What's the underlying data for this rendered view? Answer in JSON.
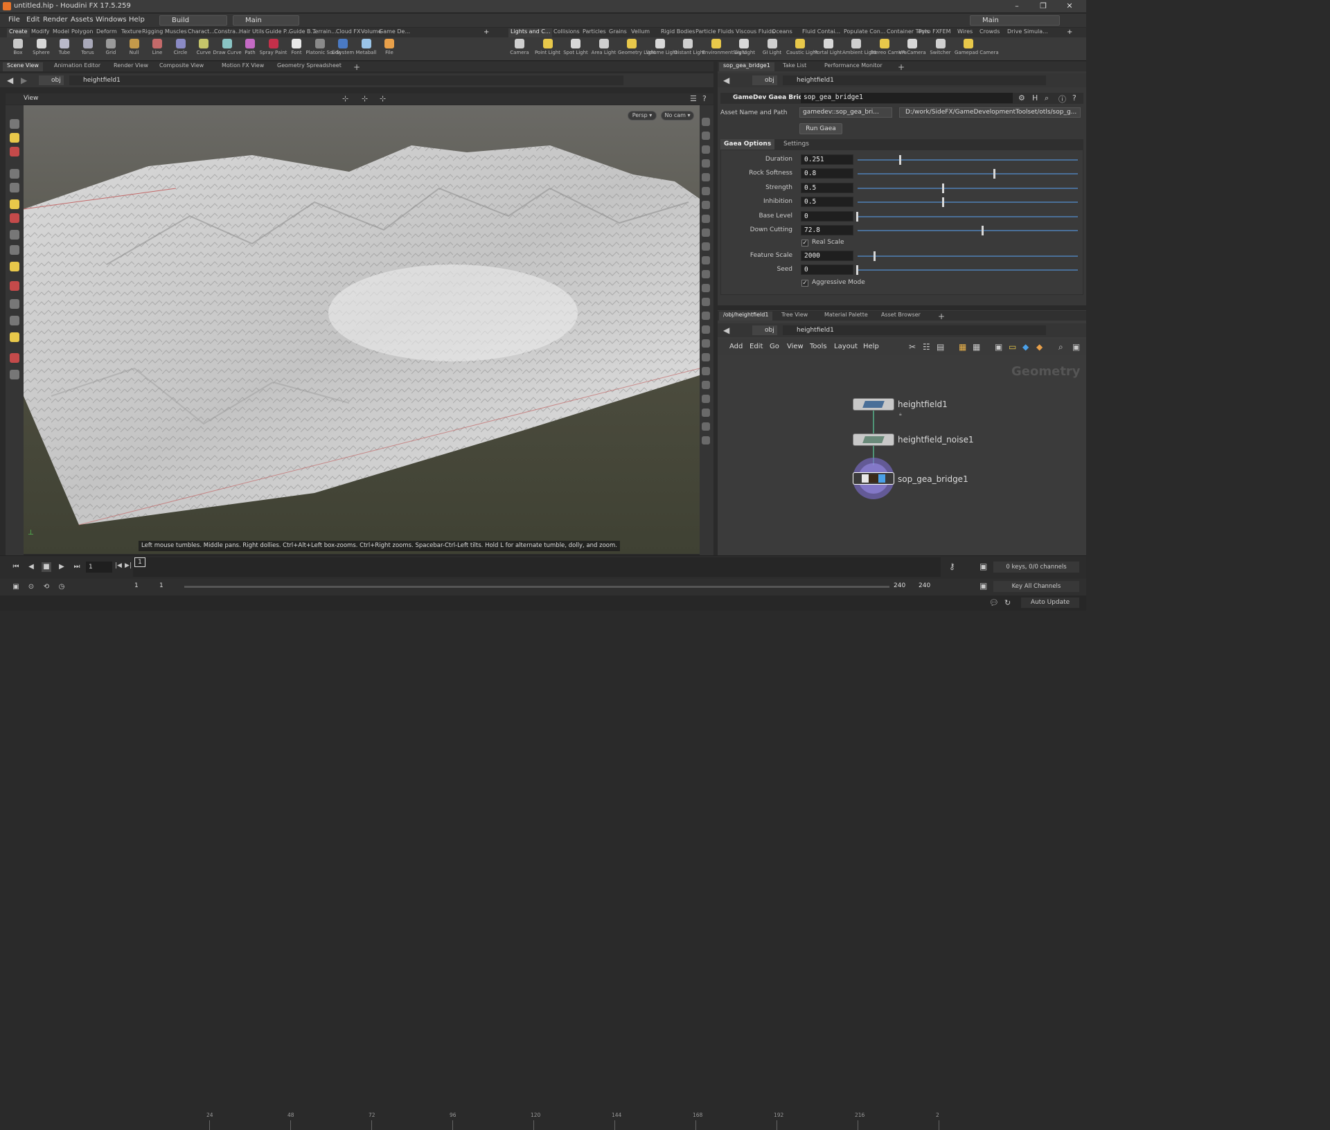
{
  "window": {
    "title": "untitled.hip - Houdini FX 17.5.259"
  },
  "menu": [
    "File",
    "Edit",
    "Render",
    "Assets",
    "Windows",
    "Help"
  ],
  "desktop": {
    "left": "Build",
    "center": "Main",
    "right": "Main"
  },
  "shelf_tabs_left": [
    "Create",
    "Modify",
    "Model",
    "Polygon",
    "Deform",
    "Texture",
    "Rigging",
    "Muscles",
    "Charact...",
    "Constra...",
    "Hair Utils",
    "Guide P...",
    "Guide B...",
    "Terrain...",
    "Cloud FX",
    "Volume",
    "Game De..."
  ],
  "shelf_tabs_right": [
    "Lights and C...",
    "Collisions",
    "Particles",
    "Grains",
    "Vellum",
    "Rigid Bodies",
    "Particle Fluids",
    "Viscous Fluids",
    "Oceans",
    "Fluid Contai...",
    "Populate Con...",
    "Container Tools",
    "Pyro FX",
    "FEM",
    "Wires",
    "Crowds",
    "Drive Simula..."
  ],
  "tools_left": [
    "Box",
    "Sphere",
    "Tube",
    "Torus",
    "Grid",
    "Null",
    "Line",
    "Circle",
    "Curve",
    "Draw Curve",
    "Path",
    "Spray Paint",
    "Font",
    "Platonic Solids",
    "L-System",
    "Metaball",
    "File"
  ],
  "tools_right": [
    "Camera",
    "Point Light",
    "Spot Light",
    "Area Light",
    "Geometry Light",
    "Volume Light",
    "Distant Light",
    "Environment Light",
    "Sky Light",
    "GI Light",
    "Caustic Light",
    "Portal Light",
    "Ambient Light",
    "Stereo Camera",
    "VR Camera",
    "Switcher",
    "Gamepad Camera"
  ],
  "pane_tabs_left": [
    "Scene View",
    "Animation Editor",
    "Render View",
    "Composite View",
    "Motion FX View",
    "Geometry Spreadsheet"
  ],
  "path_left": {
    "root": "obj",
    "node": "heightfield1"
  },
  "viewport": {
    "label": "View",
    "persp": "Persp",
    "cam": "No cam",
    "hint": "Left mouse tumbles. Middle pans. Right dollies. Ctrl+Alt+Left box-zooms. Ctrl+Right zooms. Spacebar-Ctrl-Left tilts. Hold L for alternate tumble, dolly, and zoom."
  },
  "param_tabs": [
    "sop_gea_bridge1",
    "Take List",
    "Performance Monitor"
  ],
  "param_path": {
    "root": "obj",
    "node": "heightfield1"
  },
  "params": {
    "node_type": "GameDev Gaea Bridge",
    "node_name": "sop_gea_bridge1",
    "asset_label": "Asset Name and Path",
    "asset_name": "gamedev::sop_gea_bri...",
    "asset_path": "D:/work/SideFX/GameDevelopmentToolset/otls/sop_g...",
    "run_button": "Run Gaea",
    "tabs": [
      "Gaea Options",
      "Settings"
    ],
    "fields": [
      {
        "label": "Duration",
        "value": "0.251",
        "slider": 0.251
      },
      {
        "label": "Rock Softness",
        "value": "0.8",
        "slider": 0.8
      },
      {
        "label": "Strength",
        "value": "0.5",
        "slider": 0.5
      },
      {
        "label": "Inhibition",
        "value": "0.5",
        "slider": 0.5
      },
      {
        "label": "Base Level",
        "value": "0",
        "slider": 0
      },
      {
        "label": "Down Cutting",
        "value": "72.8",
        "slider": 0.728
      }
    ],
    "real_scale": "Real Scale",
    "fields2": [
      {
        "label": "Feature Scale",
        "value": "2000",
        "slider": 0.1
      },
      {
        "label": "Seed",
        "value": "0",
        "slider": 0
      }
    ],
    "aggressive": "Aggressive Mode"
  },
  "net_tabs": [
    "/obj/heightfield1",
    "Tree View",
    "Material Palette",
    "Asset Browser"
  ],
  "net_path": {
    "root": "obj",
    "node": "heightfield1"
  },
  "net_menu": [
    "Add",
    "Edit",
    "Go",
    "View",
    "Tools",
    "Layout",
    "Help"
  ],
  "net_context": "Geometry",
  "nodes": [
    "heightfield1",
    "heightfield_noise1",
    "sop_gea_bridge1"
  ],
  "timeline": {
    "current": "1",
    "ticks": [
      "24",
      "48",
      "72",
      "96",
      "120",
      "144",
      "168",
      "192",
      "216",
      "2"
    ],
    "start": "1",
    "range_start": "1",
    "range_end": "240",
    "end": "240",
    "keys": "0 keys, 0/0 channels",
    "key_all": "Key All Channels",
    "auto_update": "Auto Update"
  },
  "colors": {
    "accent": "#4a6f98",
    "node_selected": "#7a6cc8"
  }
}
